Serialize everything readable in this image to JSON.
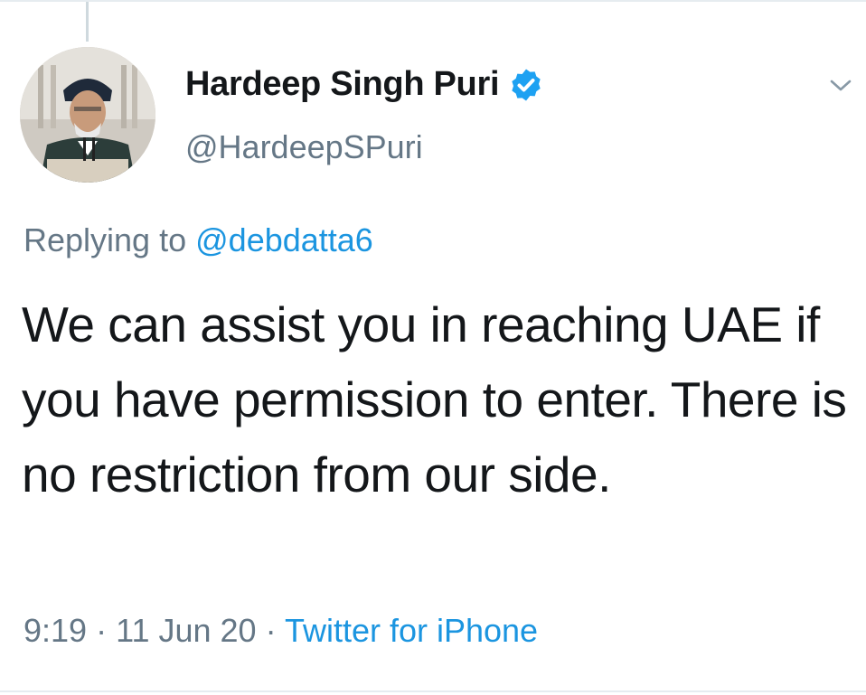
{
  "author": {
    "display_name": "Hardeep Singh Puri",
    "handle": "@HardeepSPuri",
    "verified": true
  },
  "reply": {
    "prefix": "Replying to",
    "to_handle": "@debdatta6"
  },
  "tweet": {
    "text": "We can assist you in reaching UAE if you have permission to enter. There is no restriction from our side."
  },
  "meta": {
    "time": "9:19",
    "separator": "·",
    "date": "11 Jun 20",
    "source": "Twitter for iPhone"
  },
  "icons": {
    "verified": "verified-badge-icon",
    "menu": "chevron-down-icon"
  },
  "colors": {
    "link": "#1b95e0",
    "verified": "#1da1f2",
    "secondary_text": "#657786",
    "primary_text": "#14171a"
  }
}
